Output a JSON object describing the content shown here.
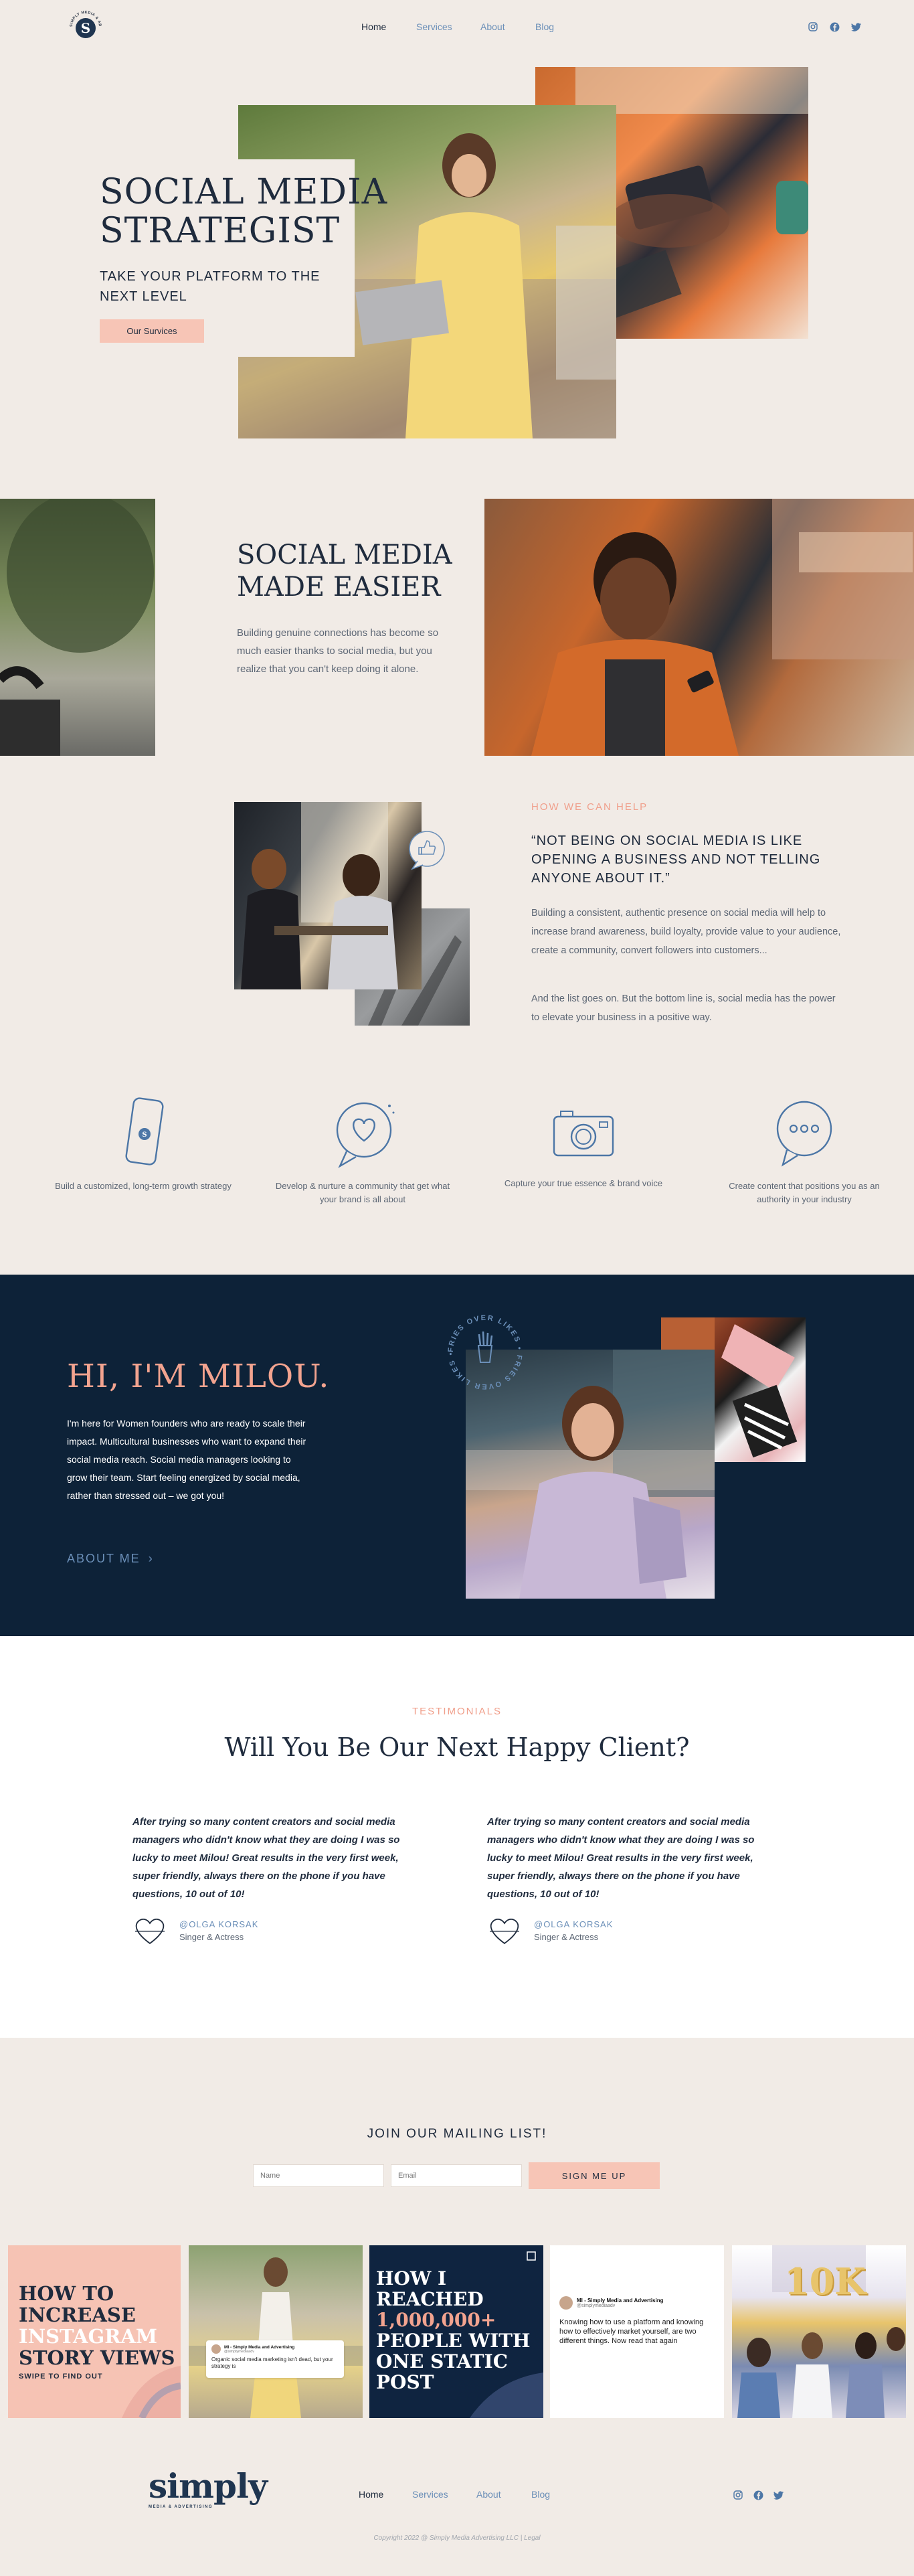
{
  "colors": {
    "background": "#f1ebe6",
    "navy": "#0d2238",
    "accent_pink": "#f7c5b6",
    "coral_text": "#f09e8a",
    "link_blue": "#6b8fb8"
  },
  "nav": {
    "logo_letter": "S",
    "logo_ring": "SIMPLY MEDIA & ADVERTISING",
    "links": [
      "Home",
      "Services",
      "About",
      "Blog"
    ],
    "social_icons": [
      "instagram-icon",
      "facebook-icon",
      "twitter-icon"
    ]
  },
  "hero": {
    "title_line1": "SOCIAL MEDIA",
    "title_line2": "STRATEGIST",
    "subtitle_line1": "TAKE YOUR PLATFORM TO THE",
    "subtitle_line2": "NEXT LEVEL",
    "button": "Our Survices"
  },
  "easier": {
    "title_line1": "SOCIAL MEDIA",
    "title_line2": "MADE EASIER",
    "body": "Building genuine connections has become so much easier thanks to social media, but you realize that you can't keep doing it alone."
  },
  "help": {
    "eyebrow": "HOW WE CAN HELP",
    "heading": "“NOT BEING ON SOCIAL MEDIA IS LIKE OPENING A BUSINESS AND NOT TELLING ANYONE ABOUT IT.”",
    "para1": "Building a consistent, authentic presence on social media will help to increase brand awareness, build loyalty, provide value to your audience, create a community, convert followers into customers...",
    "para2": "And the list goes on. But the bottom line is, social media has the power to elevate your business in a positive way."
  },
  "features": [
    {
      "icon": "phone-icon",
      "text": "Build a customized, long-term growth strategy"
    },
    {
      "icon": "heart-chat-icon",
      "text": "Develop & nurture a community that get what your brand is all about"
    },
    {
      "icon": "camera-icon",
      "text": "Capture your true essence & brand voice"
    },
    {
      "icon": "chat-bubble-icon",
      "text": "Create content that positions you as an authority in your industry"
    }
  ],
  "about": {
    "title": "HI, I'M MILOU.",
    "body": "I'm here for Women founders who are ready to scale their impact. Multicultural businesses who want to expand their social media reach. Social media managers looking to grow their team. Start feeling energized by social media, rather than stressed out – we got you!",
    "link": "ABOUT ME",
    "badge_ring": "FRIES OVER LIKES • FRIES OVER LIKES •"
  },
  "testimonials": {
    "eyebrow": "TESTIMONIALS",
    "title": "Will You Be Our Next Happy Client?",
    "items": [
      {
        "quote": "After trying so many content creators and social media managers who didn't know what they are doing I was so lucky to meet Milou! Great results in the very first week, super friendly, always there on the phone if you have questions, 10 out of 10!",
        "name": "@OLGA KORSAK",
        "role": "Singer & Actress"
      },
      {
        "quote": "After trying so many content creators and social media managers who didn't know what they are doing I was so lucky to meet Milou! Great results in the very first week, super friendly, always there on the phone if you have questions, 10 out of 10!",
        "name": "@OLGA KORSAK",
        "role": "Singer & Actress"
      }
    ]
  },
  "mailing": {
    "title": "JOIN OUR MAILING LIST!",
    "name_placeholder": "Name",
    "email_placeholder": "Email",
    "button": "SIGN ME UP"
  },
  "instagram": {
    "tile1": {
      "line1": "HOW TO",
      "line2": "INCREASE",
      "line3": "INSTAGRAM",
      "line4": "STORY VIEWS",
      "cta": "SWIPE TO FIND OUT"
    },
    "tile2": {
      "account": "MI - Simply Media and Advertising",
      "handle": "@simplymediaadv",
      "text": "Organic social media marketing isn't dead, but your strategy is"
    },
    "tile3": {
      "line1": "HOW I",
      "line2": "REACHED",
      "line3": "1,000,000+",
      "line4": "PEOPLE WITH",
      "line5": "ONE STATIC",
      "line6": "POST"
    },
    "tile4": {
      "account": "MI - Simply Media and Advertising",
      "handle": "@simplymediaadv",
      "text": "Knowing how to use a platform and knowing how to effectively market yourself, are two different things. Now read that again"
    },
    "tile5": {
      "balloon": "10K"
    }
  },
  "footer": {
    "logo": "simply",
    "logo_sub": "MEDIA & ADVERTISING",
    "links": [
      "Home",
      "Services",
      "About",
      "Blog"
    ],
    "copyright": "Copyright 2022 @ Simply Media Advertising LLC | Legal"
  }
}
